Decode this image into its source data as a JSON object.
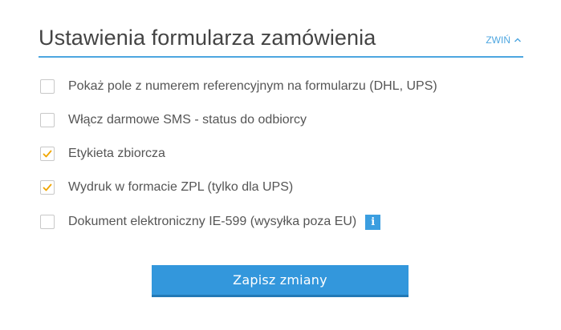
{
  "header": {
    "title": "Ustawienia formularza zamówienia",
    "collapse_label": "ZWIŃ"
  },
  "options": [
    {
      "label": "Pokaż pole z numerem referencyjnym na formularzu (DHL, UPS)",
      "checked": false
    },
    {
      "label": "Włącz darmowe SMS - status do odbiorcy",
      "checked": false
    },
    {
      "label": "Etykieta zbiorcza",
      "checked": true
    },
    {
      "label": "Wydruk w formacie ZPL (tylko dla UPS)",
      "checked": true
    },
    {
      "label": "Dokument elektroniczny IE-599 (wysyłka poza EU)",
      "checked": false,
      "info_icon": "i"
    }
  ],
  "save_button": {
    "label": "Zapisz zmiany"
  },
  "colors": {
    "accent": "#4da6e0",
    "button": "#3397dc",
    "check": "#f0a500"
  }
}
